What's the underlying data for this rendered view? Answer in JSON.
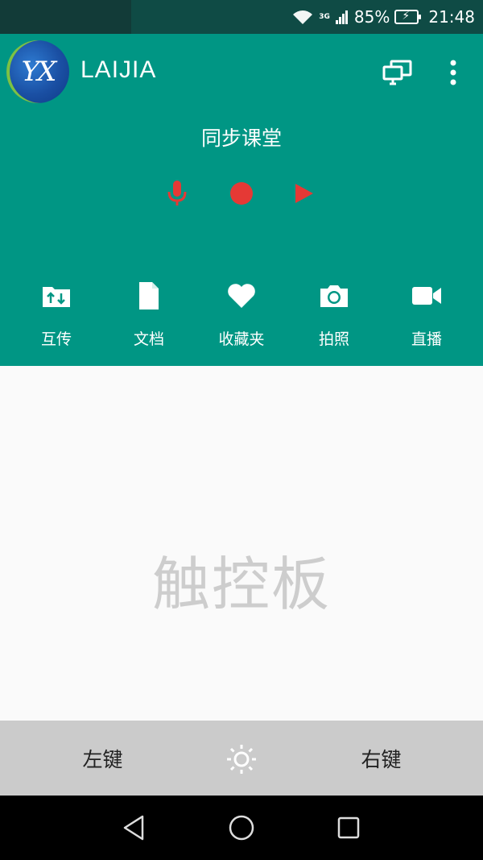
{
  "status_bar": {
    "network": "3G",
    "battery": "85%",
    "time": "21:48"
  },
  "header": {
    "logo_text": "YX",
    "app_title": "LAIJIA",
    "class_title": "同步课堂",
    "icons": [
      "monitor-icon",
      "more-vert-icon"
    ],
    "controls": [
      "mic-icon",
      "record-icon",
      "play-icon"
    ]
  },
  "tools": [
    {
      "label": "互传",
      "icon": "transfer-folder-icon"
    },
    {
      "label": "文档",
      "icon": "document-icon"
    },
    {
      "label": "收藏夹",
      "icon": "heart-icon"
    },
    {
      "label": "拍照",
      "icon": "camera-icon"
    },
    {
      "label": "直播",
      "icon": "video-camera-icon"
    }
  ],
  "touchpad": {
    "label": "触控板"
  },
  "mouse_bar": {
    "left_label": "左键",
    "right_label": "右键",
    "center_icon": "brightness-icon"
  },
  "colors": {
    "primary": "#009684",
    "accent_red": "#e53935",
    "status_bar": "#0f4b45",
    "mouse_bar": "#cbcbcb"
  }
}
